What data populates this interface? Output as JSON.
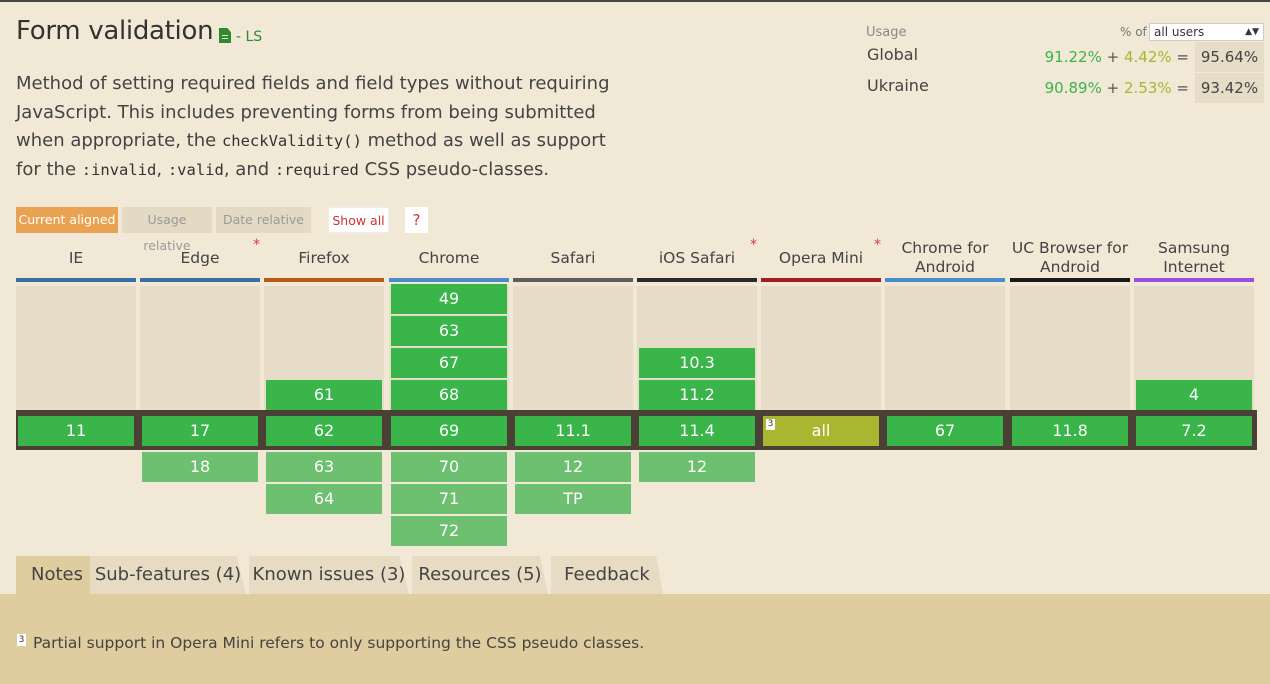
{
  "feature": {
    "title": "Form validation",
    "status": "- LS",
    "status_icon": "document-icon",
    "description_parts": [
      {
        "text": "Method of setting required fields and field types without requiring JavaScript. This includes preventing forms from being submitted when appropriate, the ",
        "code": false
      },
      {
        "text": "checkValidity()",
        "code": true
      },
      {
        "text": " method as well as support for the ",
        "code": false
      },
      {
        "text": ":invalid",
        "code": true
      },
      {
        "text": ", ",
        "code": false
      },
      {
        "text": ":valid",
        "code": true
      },
      {
        "text": ", and ",
        "code": false
      },
      {
        "text": ":required",
        "code": true
      },
      {
        "text": " CSS pseudo-classes.",
        "code": false
      }
    ]
  },
  "usage": {
    "label": "Usage",
    "pct_of": "% of",
    "selected": "all users",
    "rows": [
      {
        "name": "Global",
        "full": "91.22%",
        "plus": "+",
        "partial": "4.42%",
        "eq": "=",
        "total": "95.64%"
      },
      {
        "name": "Ukraine",
        "full": "90.89%",
        "plus": "+",
        "partial": "2.53%",
        "eq": "=",
        "total": "93.42%"
      }
    ]
  },
  "modes": {
    "current": "Current aligned",
    "relative": "Usage relative",
    "date": "Date relative",
    "show_all": "Show all",
    "help": "?"
  },
  "browsers": [
    {
      "name": "IE",
      "color": "#3a6ea5",
      "star": false,
      "past": [],
      "current": {
        "v": "11",
        "s": "y"
      },
      "future": []
    },
    {
      "name": "Edge",
      "color": "#3a6ea5",
      "star": true,
      "past": [],
      "current": {
        "v": "17",
        "s": "y"
      },
      "future": [
        {
          "v": "18",
          "s": "f"
        }
      ]
    },
    {
      "name": "Firefox",
      "color": "#b55a1a",
      "star": false,
      "past": [
        {
          "v": "61",
          "s": "y"
        }
      ],
      "current": {
        "v": "62",
        "s": "y"
      },
      "future": [
        {
          "v": "63",
          "s": "f"
        },
        {
          "v": "64",
          "s": "f"
        }
      ]
    },
    {
      "name": "Chrome",
      "color": "#4a8bc9",
      "star": false,
      "past": [
        {
          "v": "49",
          "s": "y"
        },
        {
          "v": "63",
          "s": "y"
        },
        {
          "v": "67",
          "s": "y"
        },
        {
          "v": "68",
          "s": "y"
        }
      ],
      "current": {
        "v": "69",
        "s": "y"
      },
      "future": [
        {
          "v": "70",
          "s": "f"
        },
        {
          "v": "71",
          "s": "f"
        },
        {
          "v": "72",
          "s": "f"
        }
      ]
    },
    {
      "name": "Safari",
      "color": "#5e5e5e",
      "star": false,
      "past": [],
      "current": {
        "v": "11.1",
        "s": "y"
      },
      "future": [
        {
          "v": "12",
          "s": "f"
        },
        {
          "v": "TP",
          "s": "f"
        }
      ]
    },
    {
      "name": "iOS Safari",
      "color": "#2a2a2a",
      "star": true,
      "past": [
        {
          "v": "10.3",
          "s": "y"
        },
        {
          "v": "11.2",
          "s": "y"
        }
      ],
      "current": {
        "v": "11.4",
        "s": "y"
      },
      "future": [
        {
          "v": "12",
          "s": "f"
        }
      ]
    },
    {
      "name": "Opera Mini",
      "color": "#a11d21",
      "star": true,
      "past": [],
      "current": {
        "v": "all",
        "s": "a",
        "note": "3"
      },
      "future": []
    },
    {
      "name": "Chrome for Android",
      "color": "#4a8bc9",
      "star": false,
      "past": [],
      "current": {
        "v": "67",
        "s": "y"
      },
      "future": []
    },
    {
      "name": "UC Browser for Android",
      "color": "#1a1a1a",
      "star": false,
      "past": [],
      "current": {
        "v": "11.8",
        "s": "y"
      },
      "future": []
    },
    {
      "name": "Samsung Internet",
      "color": "#9b4fe0",
      "star": false,
      "past": [
        {
          "v": "4",
          "s": "y"
        }
      ],
      "current": {
        "v": "7.2",
        "s": "y"
      },
      "future": []
    }
  ],
  "tabs": [
    "Notes",
    "Sub-features (4)",
    "Known issues (3)",
    "Resources (5)",
    "Feedback"
  ],
  "note": {
    "num": "3",
    "text": "Partial support in Opera Mini refers to only supporting the CSS pseudo classes."
  }
}
